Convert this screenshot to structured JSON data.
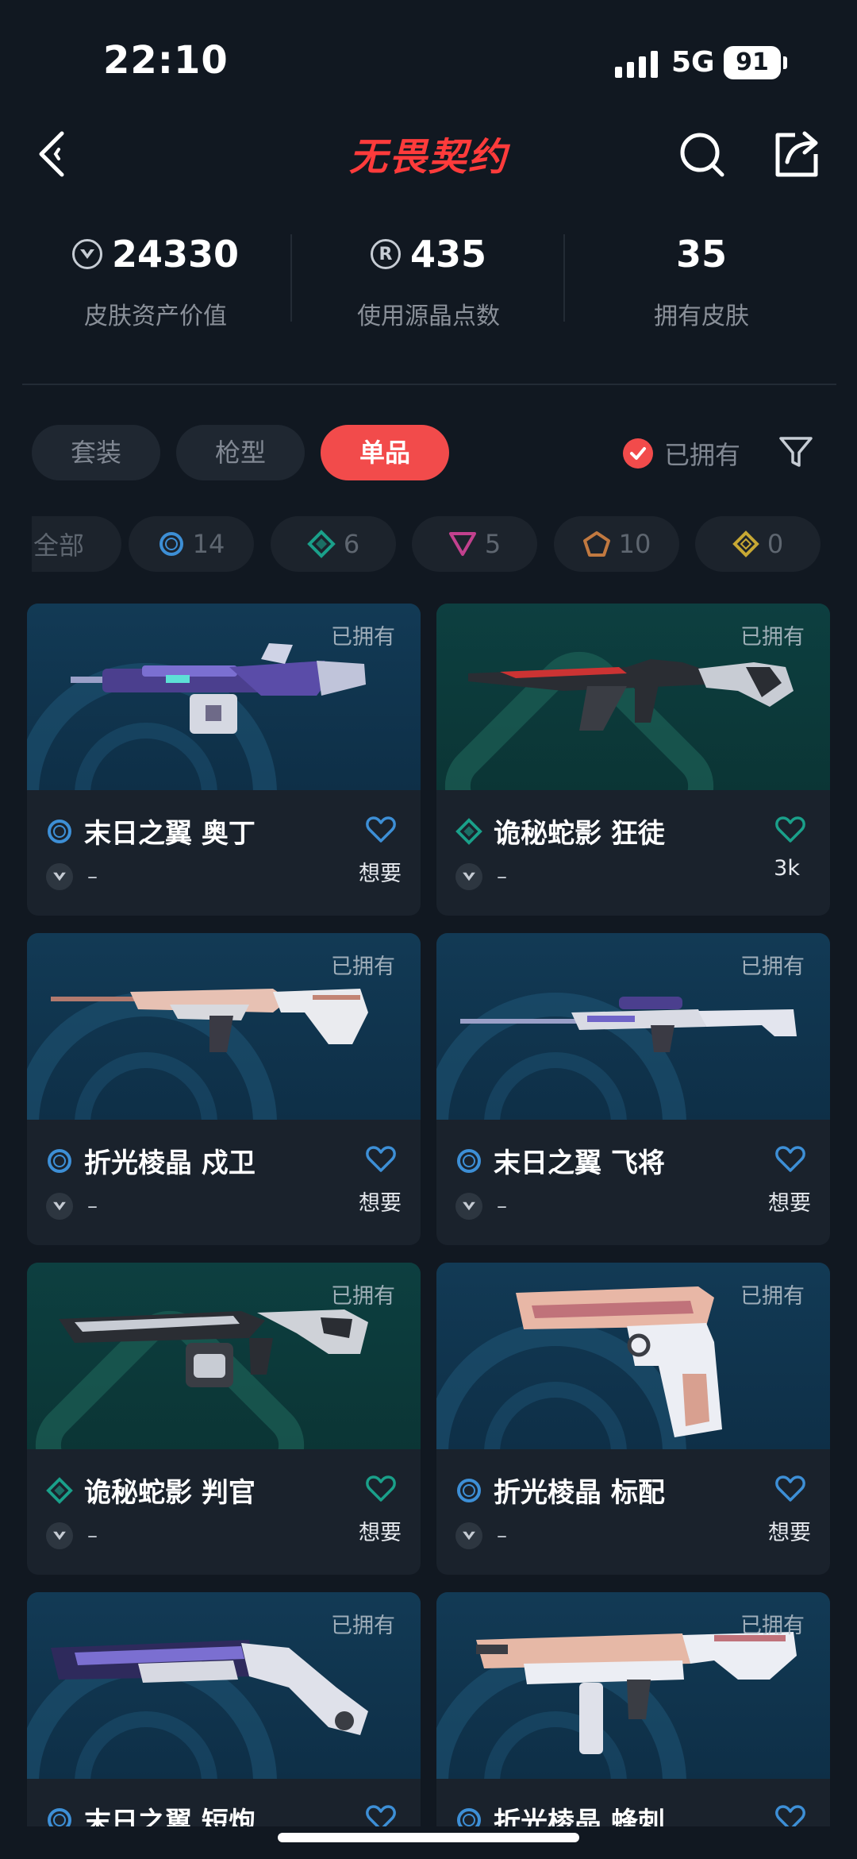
{
  "status_bar": {
    "time": "22:10",
    "network": "5G",
    "battery": "91"
  },
  "header": {
    "title": "无畏契约"
  },
  "stats": [
    {
      "value": "24330",
      "label": "皮肤资产价值",
      "icon": "vp-coin-icon"
    },
    {
      "value": "435",
      "label": "使用源晶点数",
      "icon": "radianite-icon"
    },
    {
      "value": "35",
      "label": "拥有皮肤",
      "icon": ""
    }
  ],
  "tabs": [
    {
      "label": "套装",
      "active": false
    },
    {
      "label": "枪型",
      "active": false
    },
    {
      "label": "单品",
      "active": true
    }
  ],
  "owned_filter": {
    "label": "已拥有",
    "checked": true
  },
  "tier_chips": [
    {
      "label": "全部",
      "count": "",
      "icon": ""
    },
    {
      "count": "14",
      "icon": "select-tier-icon",
      "color": "#3d8fd6"
    },
    {
      "count": "6",
      "icon": "deluxe-tier-icon",
      "color": "#1aa08a"
    },
    {
      "count": "5",
      "icon": "premium-tier-icon",
      "color": "#c2418e"
    },
    {
      "count": "10",
      "icon": "ultra-tier-icon",
      "color": "#c17940"
    },
    {
      "count": "0",
      "icon": "exclusive-tier-icon",
      "color": "#c7a834"
    }
  ],
  "colors": {
    "accent": "#f24b4b",
    "select_tier": "#3d8fd6",
    "deluxe_tier": "#1aa08a"
  },
  "cards": [
    {
      "owned_tag": "已拥有",
      "name": "末日之翼 奥丁",
      "tier": "select",
      "price": "–",
      "want": "想要",
      "bg": "blue"
    },
    {
      "owned_tag": "已拥有",
      "name": "诡秘蛇影 狂徒",
      "tier": "deluxe",
      "price": "–",
      "want": "3k",
      "bg": "teal"
    },
    {
      "owned_tag": "已拥有",
      "name": "折光棱晶 戍卫",
      "tier": "select",
      "price": "–",
      "want": "想要",
      "bg": "blue"
    },
    {
      "owned_tag": "已拥有",
      "name": "末日之翼 飞将",
      "tier": "select",
      "price": "–",
      "want": "想要",
      "bg": "blue"
    },
    {
      "owned_tag": "已拥有",
      "name": "诡秘蛇影 判官",
      "tier": "deluxe",
      "price": "–",
      "want": "想要",
      "bg": "teal"
    },
    {
      "owned_tag": "已拥有",
      "name": "折光棱晶 标配",
      "tier": "select",
      "price": "–",
      "want": "想要",
      "bg": "blue"
    },
    {
      "owned_tag": "已拥有",
      "name": "末日之翼 短炮",
      "tier": "select",
      "price": "",
      "want": "",
      "bg": "blue"
    },
    {
      "owned_tag": "已拥有",
      "name": "折光棱晶 蜂刺",
      "tier": "select",
      "price": "",
      "want": "",
      "bg": "blue"
    }
  ]
}
